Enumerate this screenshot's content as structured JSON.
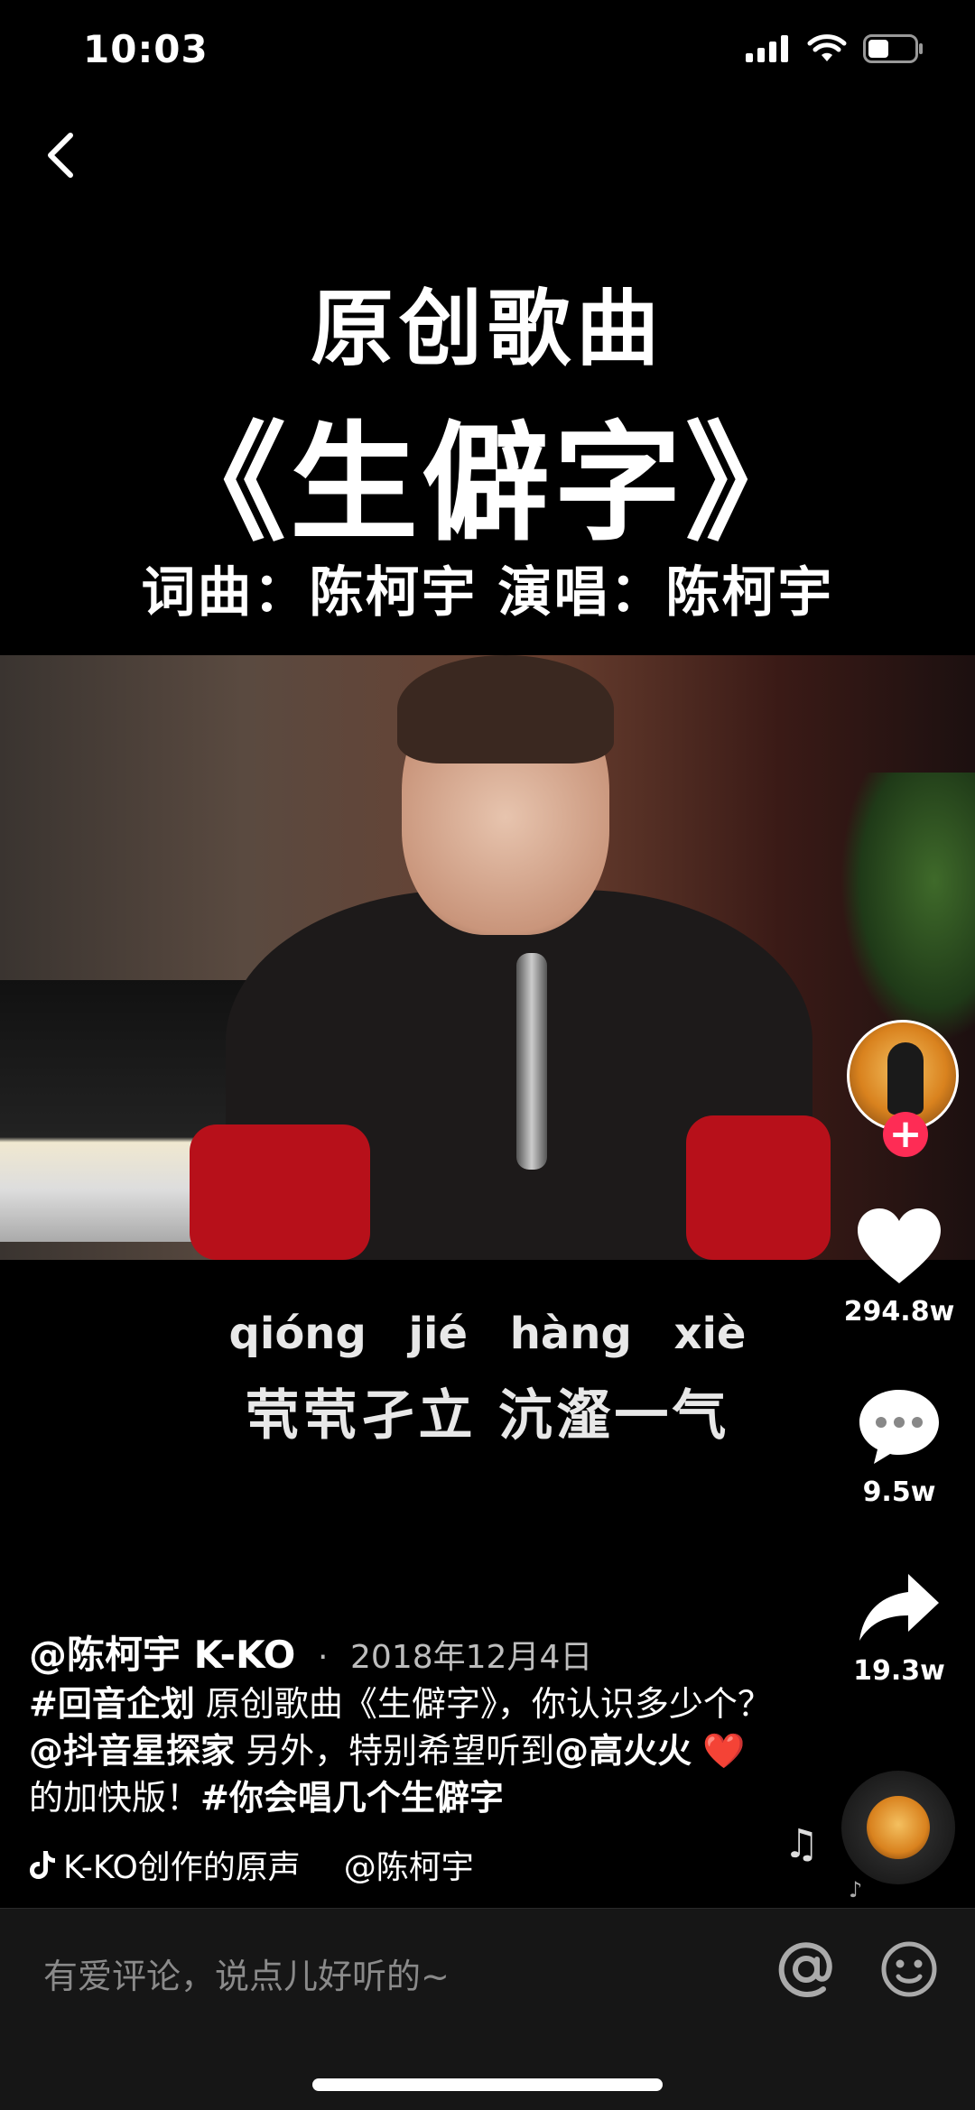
{
  "status_bar": {
    "time": "10:03"
  },
  "overlay": {
    "title_line1": "原创歌曲",
    "title_line2": "《生僻字》",
    "credits": "词曲：陈柯宇  演唱：陈柯宇"
  },
  "lyrics": {
    "pinyin": "qióng jié  hàng xiè",
    "text": "茕茕孑立 沆瀣一气"
  },
  "actions": {
    "likes": "294.8w",
    "comments": "9.5w",
    "shares": "19.3w",
    "follow_symbol": "+"
  },
  "post": {
    "author": "@陈柯宇 K-KO",
    "separator": "·",
    "date": "2018年12月4日",
    "hashtag1": "#回音企划",
    "desc_part1": " 原创歌曲《生僻字》，你认识多少个？",
    "mention1": "@抖音星探家",
    "desc_part2": " 另外，特别希望听到",
    "mention2": "@高火火",
    "heart_emoji": "❤️",
    "desc_part3": " 的加快版！",
    "hashtag2": "#你会唱几个生僻字"
  },
  "music": {
    "title": "K-KO创作的原声",
    "mention": "@陈柯宇"
  },
  "comment_bar": {
    "placeholder": "有爱评论，说点儿好听的~"
  },
  "icons": [
    "back-icon",
    "signal-icon",
    "wifi-icon",
    "battery-icon",
    "heart-icon",
    "comment-icon",
    "share-icon",
    "music-note-icon",
    "tiktok-logo-icon",
    "at-icon",
    "emoji-icon"
  ],
  "colors": {
    "background": "#000000",
    "follow": "#fe2c55",
    "comment_bar": "#161616"
  }
}
